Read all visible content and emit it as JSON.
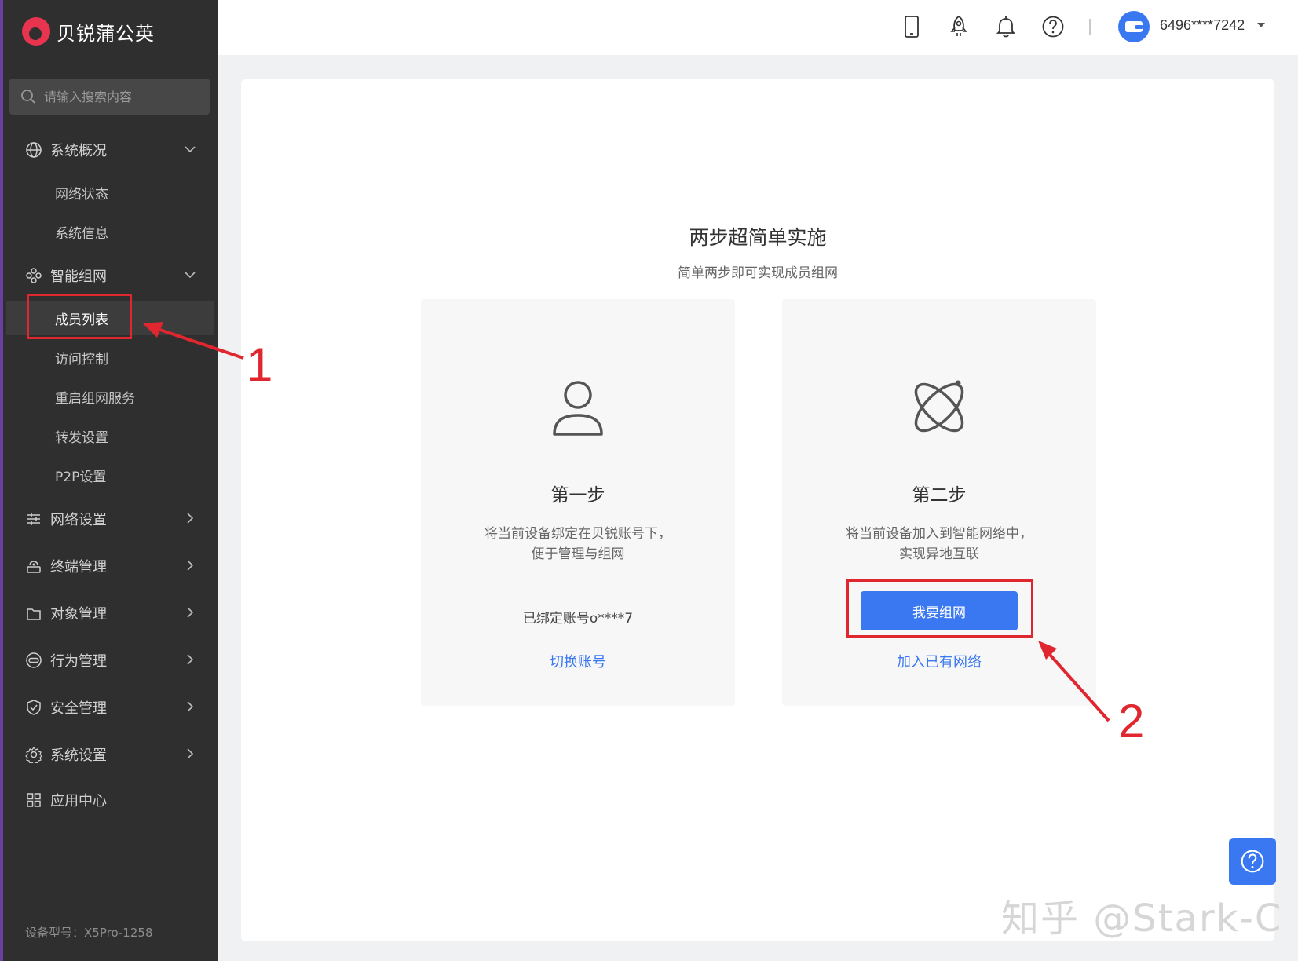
{
  "app": {
    "brand": "贝锐蒲公英",
    "device_model": "设备型号：X5Pro-1258"
  },
  "search": {
    "placeholder": "请输入搜索内容"
  },
  "sidebar": {
    "groups": [
      {
        "label": "系统概况",
        "icon": "globe-icon",
        "expanded": true,
        "items": [
          "网络状态",
          "系统信息"
        ]
      },
      {
        "label": "智能组网",
        "icon": "cluster-icon",
        "expanded": true,
        "items": [
          "成员列表",
          "访问控制",
          "重启组网服务",
          "转发设置",
          "P2P设置"
        ]
      },
      {
        "label": "网络设置",
        "icon": "sliders-icon"
      },
      {
        "label": "终端管理",
        "icon": "terminal-icon"
      },
      {
        "label": "对象管理",
        "icon": "folder-icon"
      },
      {
        "label": "行为管理",
        "icon": "link-icon"
      },
      {
        "label": "安全管理",
        "icon": "shield-icon"
      },
      {
        "label": "系统设置",
        "icon": "gear-icon"
      },
      {
        "label": "应用中心",
        "icon": "apps-icon"
      }
    ],
    "active_item": "成员列表"
  },
  "topbar": {
    "icons": [
      "mobile-icon",
      "rocket-icon",
      "bell-icon",
      "help-icon"
    ],
    "user": {
      "name": "6496****7242"
    }
  },
  "main": {
    "title": "两步超简单实施",
    "subtitle": "简单两步即可实现成员组网",
    "step1": {
      "title": "第一步",
      "desc_line1": "将当前设备绑定在贝锐账号下，",
      "desc_line2": "便于管理与组网",
      "bound": "已绑定账号o****7",
      "link": "切换账号"
    },
    "step2": {
      "title": "第二步",
      "desc_line1": "将当前设备加入到智能网络中，",
      "desc_line2": "实现异地互联",
      "button": "我要组网",
      "link": "加入已有网络"
    }
  },
  "annotations": {
    "one": "1",
    "two": "2"
  },
  "watermark": "知乎 @Stark-C",
  "colors": {
    "accent": "#3a78f2",
    "annotation": "#e0262f",
    "sidebar_bg": "#2f2f2f",
    "brand": "#e8344e"
  }
}
